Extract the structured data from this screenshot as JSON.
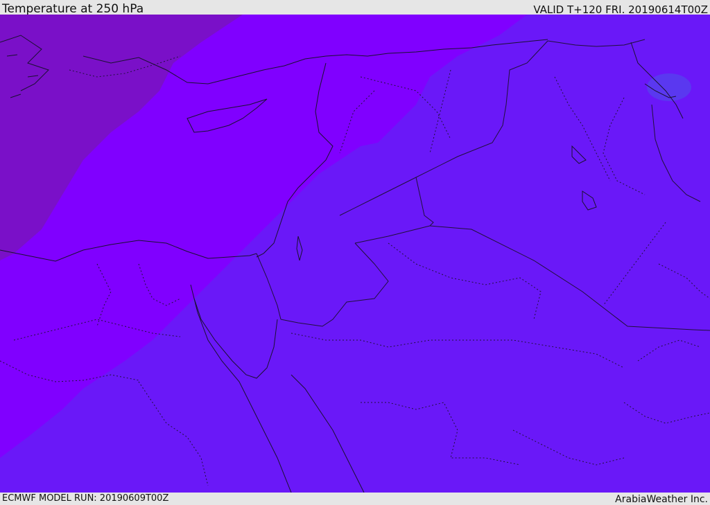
{
  "header": {
    "title": "Temperature at 250 hPa",
    "valid": "VALID T+120 FRI. 20190614T00Z"
  },
  "footer": {
    "model_run": "ECMWF MODEL RUN: 20190609T00Z",
    "credit": "ArabiaWeather Inc."
  },
  "map": {
    "colors": {
      "warm_band": "#6a18f8",
      "mid_band": "#8000ff",
      "cold_band": "#7a10c8",
      "cold_spot": "#5a38f0",
      "coastline": "#1a1030",
      "border": "#20103a"
    }
  }
}
